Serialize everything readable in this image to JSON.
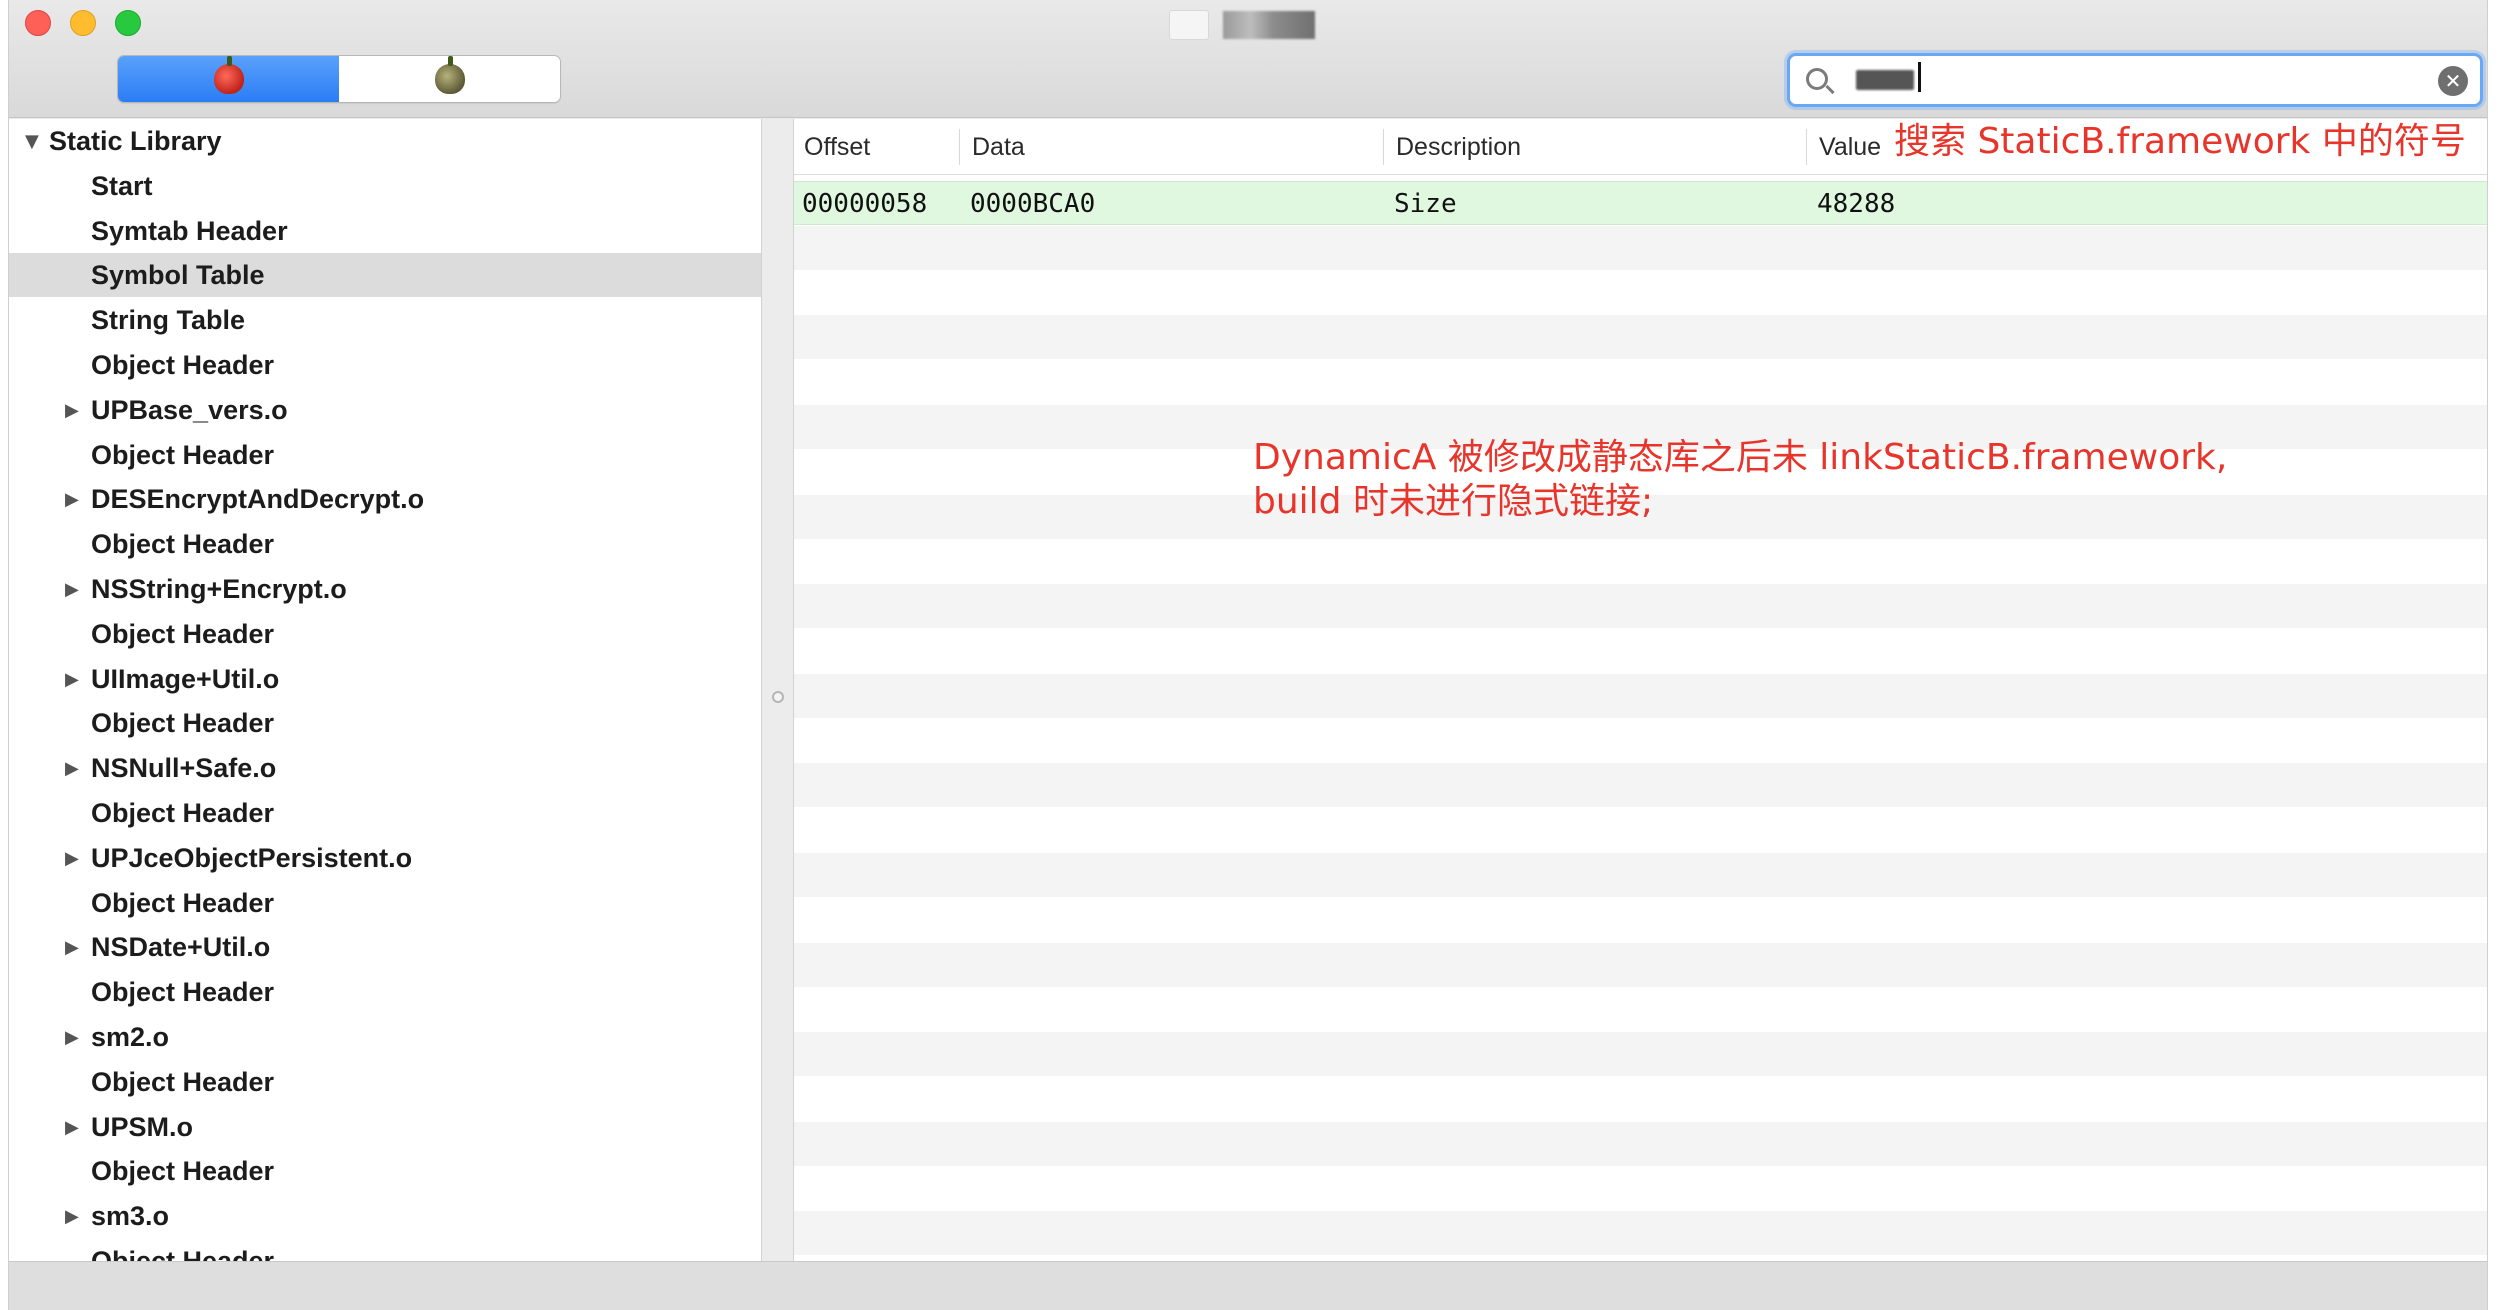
{
  "window": {
    "title": ""
  },
  "toolbar": {
    "segments": [
      {
        "name": "segment-red-apple",
        "active": true
      },
      {
        "name": "segment-green-apple",
        "active": false
      }
    ]
  },
  "search": {
    "value": "",
    "placeholder": "",
    "clear_icon": "✕"
  },
  "sidebar": {
    "root": "Static Library",
    "items": [
      {
        "label": "Start",
        "expandable": false
      },
      {
        "label": "Symtab Header",
        "expandable": false
      },
      {
        "label": "Symbol Table",
        "expandable": false,
        "selected": true
      },
      {
        "label": "String Table",
        "expandable": false
      },
      {
        "label": "Object Header",
        "expandable": false
      },
      {
        "label": "UPBase_vers.o",
        "expandable": true
      },
      {
        "label": "Object Header",
        "expandable": false
      },
      {
        "label": "DESEncryptAndDecrypt.o",
        "expandable": true
      },
      {
        "label": "Object Header",
        "expandable": false
      },
      {
        "label": "NSString+Encrypt.o",
        "expandable": true
      },
      {
        "label": "Object Header",
        "expandable": false
      },
      {
        "label": "UIImage+Util.o",
        "expandable": true
      },
      {
        "label": "Object Header",
        "expandable": false
      },
      {
        "label": "NSNull+Safe.o",
        "expandable": true
      },
      {
        "label": "Object Header",
        "expandable": false
      },
      {
        "label": "UPJceObjectPersistent.o",
        "expandable": true
      },
      {
        "label": "Object Header",
        "expandable": false
      },
      {
        "label": "NSDate+Util.o",
        "expandable": true
      },
      {
        "label": "Object Header",
        "expandable": false
      },
      {
        "label": "sm2.o",
        "expandable": true
      },
      {
        "label": "Object Header",
        "expandable": false
      },
      {
        "label": "UPSM.o",
        "expandable": true
      },
      {
        "label": "Object Header",
        "expandable": false
      },
      {
        "label": "sm3.o",
        "expandable": true
      },
      {
        "label": "Object Header",
        "expandable": false
      }
    ]
  },
  "table": {
    "columns": [
      "Offset",
      "Data",
      "Description",
      "Value"
    ],
    "rows": [
      {
        "offset": "00000058",
        "data": "0000BCA0",
        "description": "Size",
        "value": "48288"
      }
    ]
  },
  "annotations": {
    "search_note": "搜索 StaticB.framework 中的符号",
    "main_note_line1": "DynamicA 被修改成静态库之后未 linkStaticB.framework,",
    "main_note_line2": "build 时未进行隐式链接;"
  },
  "colors": {
    "annotation": "#e8352b",
    "highlight_row": "#e0f8df",
    "segment_active": "#2b7df6"
  }
}
